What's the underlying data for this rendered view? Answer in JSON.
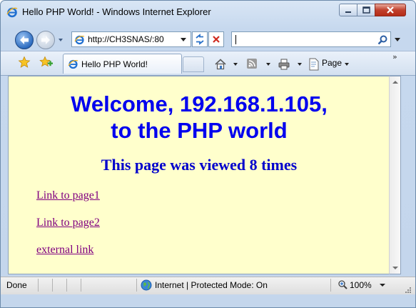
{
  "window": {
    "title": "Hello PHP World! - Windows Internet Explorer",
    "icon": "ie-logo-icon"
  },
  "navigation": {
    "address": "http://CH3SNAS/:80",
    "search_value": "",
    "icons": [
      "back-arrow-icon",
      "forward-arrow-icon",
      "page-icon",
      "refresh-icon",
      "stop-icon",
      "search-icon"
    ]
  },
  "command_bar": {
    "tab_label": "Hello PHP World!",
    "page_menu": "Page",
    "overflow": "»",
    "icons": [
      "favorites-star-icon",
      "add-favorites-icon",
      "home-icon",
      "feeds-icon",
      "print-icon",
      "page-icon"
    ]
  },
  "page": {
    "background": "#ffffcc",
    "heading_line1": "Welcome, 192.168.1.105,",
    "heading_line2": "to the PHP world",
    "view_count": "This page was viewed 8 times",
    "links": [
      "Link to page1",
      "Link to page2",
      "external link"
    ],
    "heading_color": "#0000ee",
    "link_color": "#800080"
  },
  "status_bar": {
    "status": "Done",
    "zone": "Internet | Protected Mode: On",
    "zoom": "100%",
    "icons": [
      "globe-icon",
      "zoom-icon"
    ]
  }
}
